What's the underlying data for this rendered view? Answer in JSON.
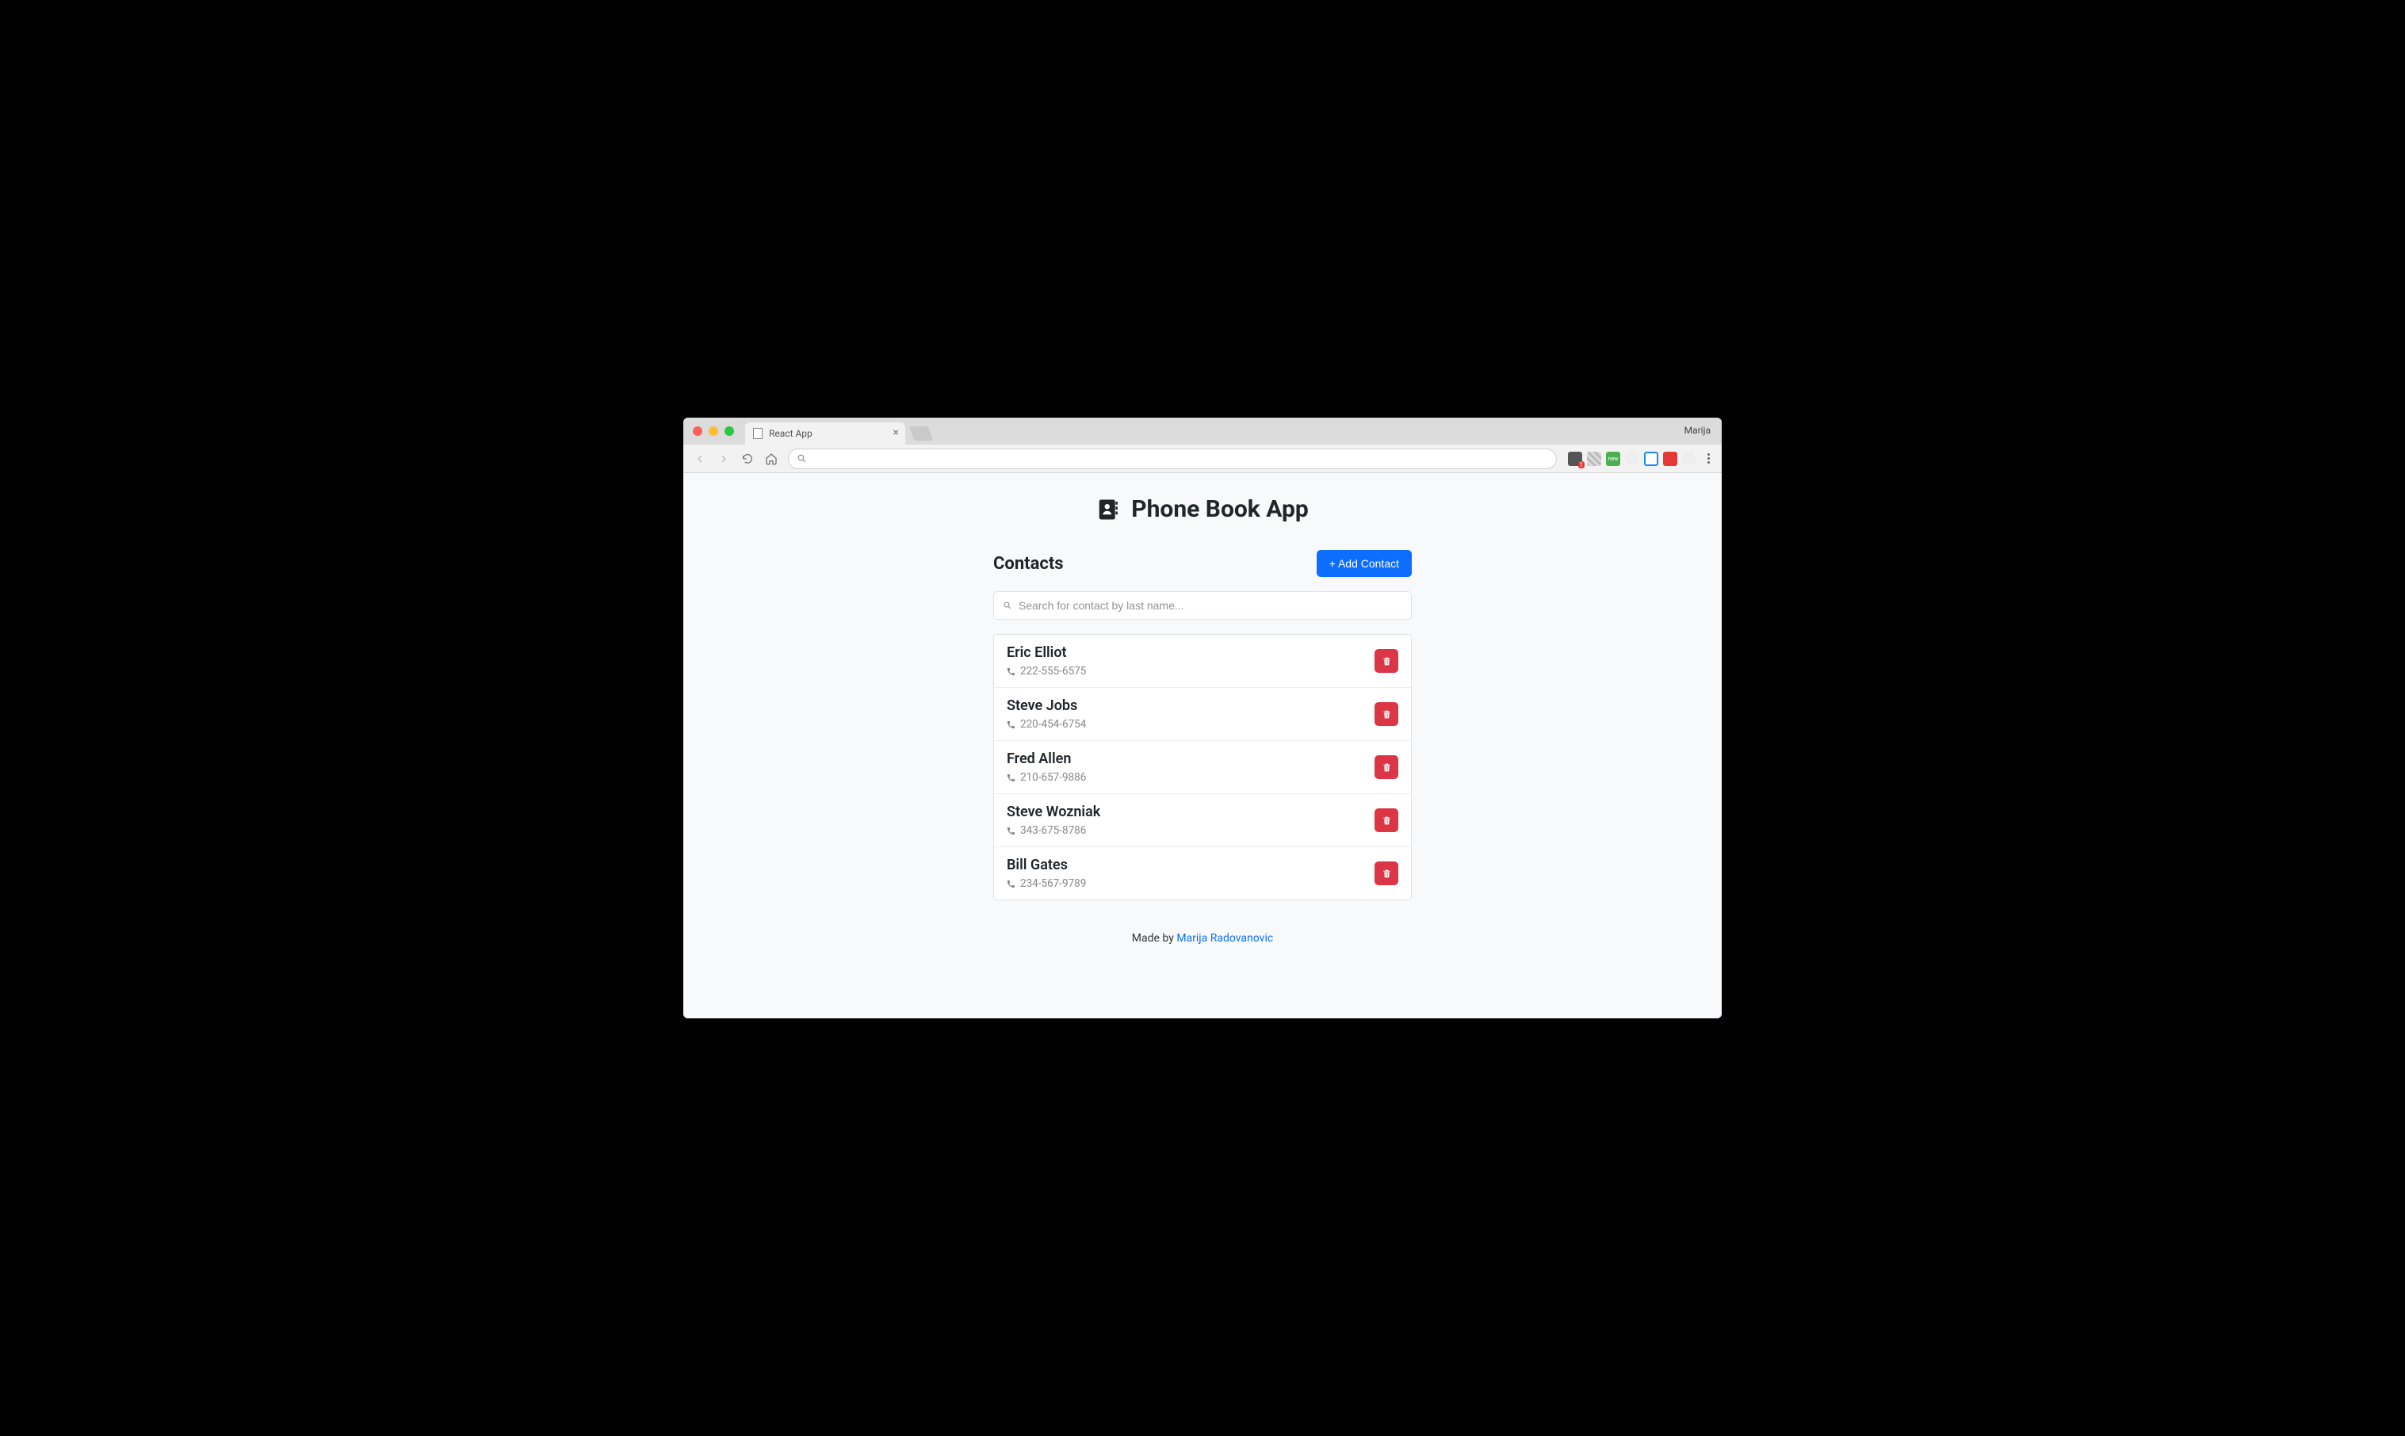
{
  "browser": {
    "tab_title": "React App",
    "profile_name": "Marija",
    "ext_new_label": "new"
  },
  "app": {
    "title": "Phone Book App"
  },
  "contacts_section": {
    "heading": "Contacts",
    "add_button": "+ Add Contact",
    "search_placeholder": "Search for contact by last name..."
  },
  "contacts": [
    {
      "name": "Eric Elliot",
      "phone": "222-555-6575"
    },
    {
      "name": "Steve Jobs",
      "phone": "220-454-6754"
    },
    {
      "name": "Fred Allen",
      "phone": "210-657-9886"
    },
    {
      "name": "Steve Wozniak",
      "phone": "343-675-8786"
    },
    {
      "name": "Bill Gates",
      "phone": "234-567-9789"
    }
  ],
  "footer": {
    "prefix": "Made by ",
    "author": "Marija Radovanovic"
  }
}
